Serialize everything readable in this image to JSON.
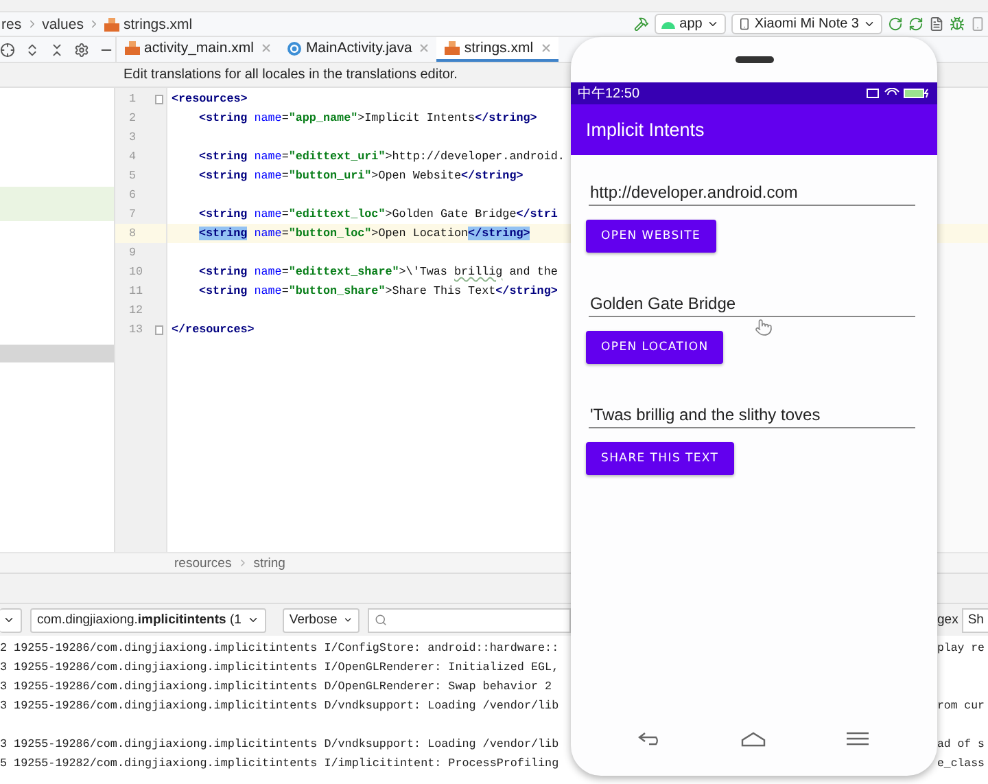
{
  "breadcrumb": [
    "res",
    "values",
    "strings.xml"
  ],
  "run_toolbar": {
    "config": "app",
    "device": "Xiaomi Mi Note 3"
  },
  "editor_tabs": [
    {
      "label": "activity_main.xml",
      "kind": "xml",
      "selected": false
    },
    {
      "label": "MainActivity.java",
      "kind": "java",
      "selected": false
    },
    {
      "label": "strings.xml",
      "kind": "xml",
      "selected": true
    }
  ],
  "banner": "Edit translations for all locales in the translations editor.",
  "code_lines": [
    {
      "number": "1",
      "indented": false,
      "current": false,
      "fold": true,
      "segments": [
        {
          "kind": "tag",
          "text": "<resources>"
        }
      ]
    },
    {
      "number": "2",
      "indented": true,
      "current": false,
      "fold": false,
      "segments": [
        {
          "kind": "tag",
          "text": "<string"
        },
        {
          "kind": "attr",
          "text": " name"
        },
        {
          "kind": "plain",
          "text": "="
        },
        {
          "kind": "value",
          "text": "\"app_name\""
        },
        {
          "kind": "plain",
          "text": ">Implicit Intents"
        },
        {
          "kind": "tag",
          "text": "</string>"
        }
      ]
    },
    {
      "number": "3",
      "indented": false,
      "current": false,
      "fold": false
    },
    {
      "number": "4",
      "indented": true,
      "current": false,
      "fold": false,
      "segments": [
        {
          "kind": "tag",
          "text": "<string"
        },
        {
          "kind": "attr",
          "text": " name"
        },
        {
          "kind": "plain",
          "text": "="
        },
        {
          "kind": "value",
          "text": "\"edittext_uri\""
        },
        {
          "kind": "plain",
          "text": ">http://developer.android."
        }
      ]
    },
    {
      "number": "5",
      "indented": true,
      "current": false,
      "fold": false,
      "segments": [
        {
          "kind": "tag",
          "text": "<string"
        },
        {
          "kind": "attr",
          "text": " name"
        },
        {
          "kind": "plain",
          "text": "="
        },
        {
          "kind": "value",
          "text": "\"button_uri\""
        },
        {
          "kind": "plain",
          "text": ">Open Website"
        },
        {
          "kind": "tag",
          "text": "</string>"
        }
      ]
    },
    {
      "number": "6",
      "indented": false,
      "current": false,
      "fold": false
    },
    {
      "number": "7",
      "indented": true,
      "current": false,
      "fold": false,
      "segments": [
        {
          "kind": "tag",
          "text": "<string"
        },
        {
          "kind": "attr",
          "text": " name"
        },
        {
          "kind": "plain",
          "text": "="
        },
        {
          "kind": "value",
          "text": "\"edittext_loc\""
        },
        {
          "kind": "plain",
          "text": ">Golden Gate Bridge"
        },
        {
          "kind": "tag",
          "text": "</stri"
        }
      ]
    },
    {
      "number": "8",
      "indented": true,
      "current": true,
      "fold": false,
      "segments": [
        {
          "kind": "match",
          "text": "<string"
        },
        {
          "kind": "attr",
          "text": " name"
        },
        {
          "kind": "plain",
          "text": "="
        },
        {
          "kind": "value",
          "text": "\"button_loc\""
        },
        {
          "kind": "plain",
          "text": ">Open Location"
        },
        {
          "kind": "match",
          "text": "</string>"
        }
      ]
    },
    {
      "number": "9",
      "indented": false,
      "current": false,
      "fold": false
    },
    {
      "number": "10",
      "indented": true,
      "current": false,
      "fold": false,
      "segments": [
        {
          "kind": "tag",
          "text": "<string"
        },
        {
          "kind": "attr",
          "text": " name"
        },
        {
          "kind": "plain",
          "text": "="
        },
        {
          "kind": "value",
          "text": "\"edittext_share\""
        },
        {
          "kind": "plain",
          "text": ">\\'Twas "
        },
        {
          "kind": "typo",
          "text": "brillig"
        },
        {
          "kind": "plain",
          "text": " and the"
        }
      ]
    },
    {
      "number": "11",
      "indented": true,
      "current": false,
      "fold": false,
      "segments": [
        {
          "kind": "tag",
          "text": "<string"
        },
        {
          "kind": "attr",
          "text": " name"
        },
        {
          "kind": "plain",
          "text": "="
        },
        {
          "kind": "value",
          "text": "\"button_share\""
        },
        {
          "kind": "plain",
          "text": ">Share This Text"
        },
        {
          "kind": "tag",
          "text": "</string>"
        }
      ]
    },
    {
      "number": "12",
      "indented": false,
      "current": false,
      "fold": false
    },
    {
      "number": "13",
      "indented": false,
      "current": false,
      "fold": true,
      "segments": [
        {
          "kind": "tag",
          "text": "</resources>"
        }
      ]
    }
  ],
  "editor_breadcrumb": [
    "resources",
    "string"
  ],
  "logcat": {
    "package": "com.dingjiaxiong.**implicitintents** (1",
    "level": "Verbose",
    "regex_label": "gex",
    "show_label": "Sh",
    "lines": [
      {
        "kind": "entry",
        "text": "2 19255-19286/com.dingjiaxiong.implicitintents I/ConfigStore: android::hardware::",
        "tail": "play re"
      },
      {
        "kind": "entry",
        "text": "3 19255-19286/com.dingjiaxiong.implicitintents I/OpenGLRenderer: Initialized EGL,"
      },
      {
        "kind": "entry",
        "text": "3 19255-19286/com.dingjiaxiong.implicitintents D/OpenGLRenderer: Swap behavior 2"
      },
      {
        "kind": "entry",
        "text": "3 19255-19286/com.dingjiaxiong.implicitintents D/vndksupport: Loading /vendor/lib",
        "tail": "rom cur"
      },
      {
        "kind": "blank"
      },
      {
        "kind": "entry",
        "text": "3 19255-19286/com.dingjiaxiong.implicitintents D/vndksupport: Loading /vendor/lib",
        "tail": "ad of s"
      },
      {
        "kind": "entry",
        "text": "5 19255-19282/com.dingjiaxiong.implicitintents I/implicitintent: ProcessProfiling",
        "tail": "e_class"
      }
    ]
  },
  "phone": {
    "time": "中午12:50",
    "app_title": "Implicit Intents",
    "groups": [
      {
        "value": "http://developer.android.com",
        "button": "OPEN WEBSITE"
      },
      {
        "value": "Golden Gate Bridge",
        "button": "OPEN LOCATION"
      },
      {
        "value": "'Twas brillig and the slithy toves",
        "button": "SHARE THIS TEXT"
      }
    ]
  }
}
